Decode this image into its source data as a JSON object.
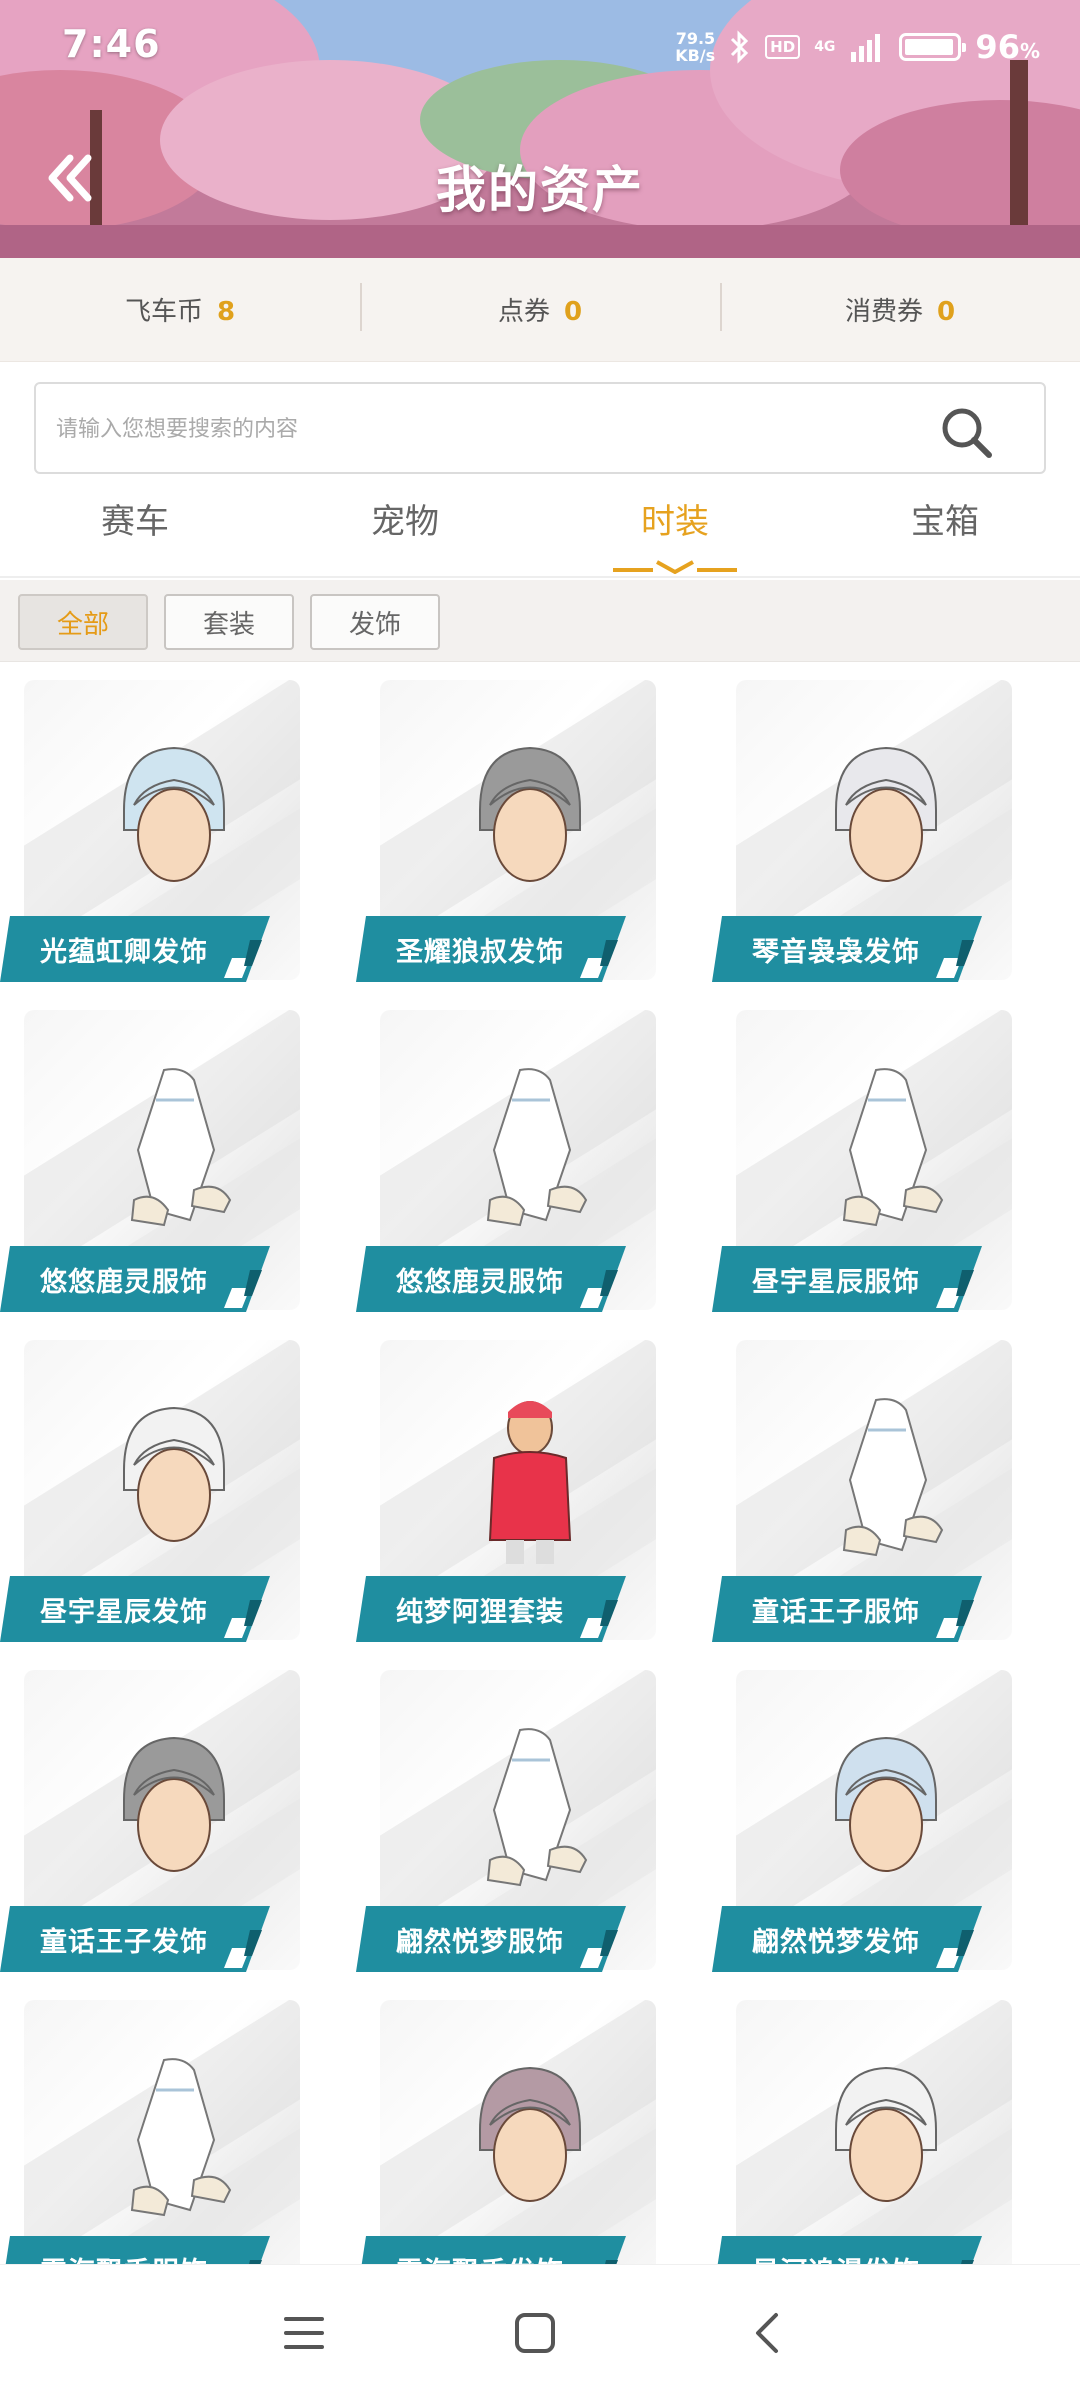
{
  "status_bar": {
    "time": "7:46",
    "speed_value": "79.5",
    "speed_unit": "KB/s",
    "hd": "HD",
    "network": "4G",
    "battery_level": 0.96,
    "battery": "96",
    "battery_unit": "%"
  },
  "header": {
    "title": "我的资产",
    "back_icon": "double-chevron-left-icon"
  },
  "currency": [
    {
      "label": "飞车币",
      "value": "8"
    },
    {
      "label": "点券",
      "value": "0"
    },
    {
      "label": "消费券",
      "value": "0"
    }
  ],
  "search": {
    "placeholder": "请输入您想要搜索的内容",
    "value": "",
    "icon": "search-icon"
  },
  "tabs": [
    {
      "label": "赛车",
      "active": false
    },
    {
      "label": "宠物",
      "active": false
    },
    {
      "label": "时装",
      "active": true
    },
    {
      "label": "宝箱",
      "active": false
    }
  ],
  "filters": [
    {
      "label": "全部",
      "active": true
    },
    {
      "label": "套装",
      "active": false
    },
    {
      "label": "发饰",
      "active": false
    }
  ],
  "items": [
    {
      "name": "光蕴虹卿发饰",
      "kind": "hair"
    },
    {
      "name": "圣耀狼叔发饰",
      "kind": "hair"
    },
    {
      "name": "琴音袅袅发饰",
      "kind": "hair"
    },
    {
      "name": "悠悠鹿灵服饰",
      "kind": "outfit"
    },
    {
      "name": "悠悠鹿灵服饰",
      "kind": "outfit"
    },
    {
      "name": "昼宇星辰服饰",
      "kind": "outfit"
    },
    {
      "name": "昼宇星辰发饰",
      "kind": "hair"
    },
    {
      "name": "纯梦阿狸套装",
      "kind": "suit"
    },
    {
      "name": "童话王子服饰",
      "kind": "outfit"
    },
    {
      "name": "童话王子发饰",
      "kind": "hair"
    },
    {
      "name": "翩然悦梦服饰",
      "kind": "outfit"
    },
    {
      "name": "翩然悦梦发饰",
      "kind": "hair"
    },
    {
      "name": "雪海飘香服饰",
      "kind": "outfit"
    },
    {
      "name": "雪海飘香发饰",
      "kind": "hair"
    },
    {
      "name": "星河追漫发饰",
      "kind": "hair"
    }
  ],
  "colors": {
    "accent": "#e6a21f",
    "label_bg": "#1f8ea0",
    "label_dark": "#0f5f6e"
  },
  "nav": {
    "menu_icon": "menu-icon",
    "home_icon": "home-square-icon",
    "back_icon": "back-chevron-icon"
  }
}
